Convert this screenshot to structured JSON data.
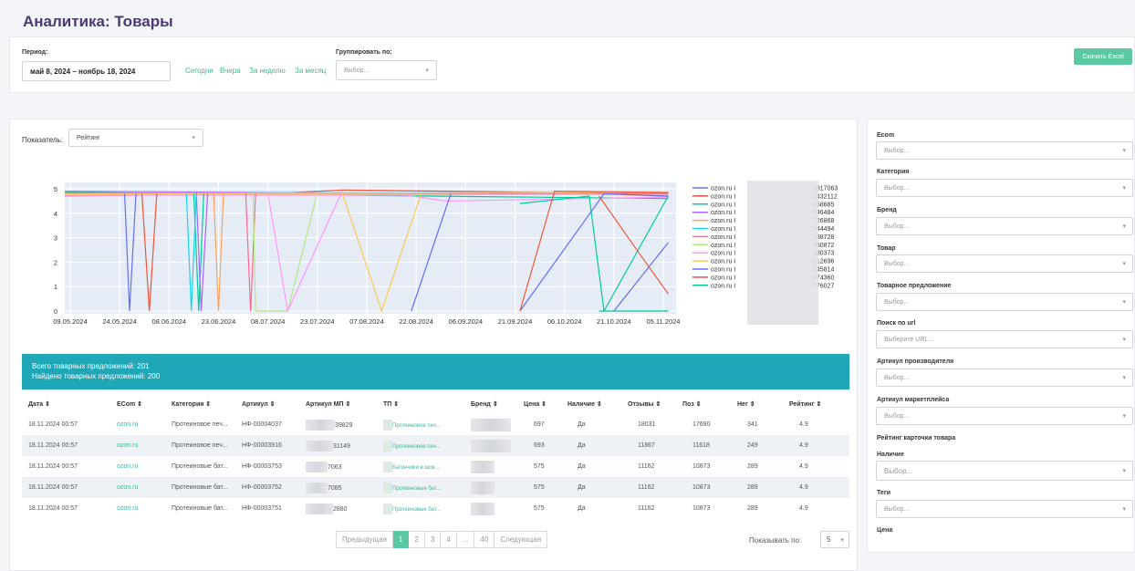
{
  "page_title": "Аналитика: Товары",
  "filters": {
    "period_label": "Период:",
    "period_value": "май 8, 2024 – ноябрь 18, 2024",
    "quick_links": [
      "Сегодня",
      "Вчера",
      "За неделю",
      "За месяц"
    ],
    "group_label": "Группировать по:",
    "group_placeholder": "Выбор...",
    "excel_button": "Скачать Excel"
  },
  "metric": {
    "label": "Показатель:",
    "value": "Рейтинг"
  },
  "chart_data": {
    "type": "line",
    "x": [
      "09.05.2024",
      "24.05.2024",
      "08.06.2024",
      "23.06.2024",
      "08.07.2024",
      "23.07.2024",
      "07.08.2024",
      "22.08.2024",
      "06.09.2024",
      "21.09.2024",
      "06.10.2024",
      "21.10.2024",
      "05.11.2024"
    ],
    "y_ticks": [
      "0",
      "1",
      "2",
      "3",
      "4",
      "5"
    ],
    "ylim": [
      0,
      5
    ],
    "legend_position": "right",
    "series": [
      {
        "name": "ozon.ru I",
        "suffix": "1817063",
        "color": "#636efa"
      },
      {
        "name": "ozon.ru I",
        "suffix": "7432112",
        "color": "#ef553b"
      },
      {
        "name": "ozon.ru I",
        "suffix": "458685",
        "color": "#00cc96"
      },
      {
        "name": "ozon.ru I",
        "suffix": "746484",
        "color": "#ab63fa"
      },
      {
        "name": "ozon.ru I",
        "suffix": "726868",
        "color": "#ffa15a"
      },
      {
        "name": "ozon.ru I",
        "suffix": "344494",
        "color": "#19d3f3"
      },
      {
        "name": "ozon.ru I",
        "suffix": "338728",
        "color": "#ff6692"
      },
      {
        "name": "ozon.ru I",
        "suffix": "350872",
        "color": "#b6e880"
      },
      {
        "name": "ozon.ru I",
        "suffix": "380373",
        "color": "#ff97ff"
      },
      {
        "name": "ozon.ru I",
        "suffix": "512696",
        "color": "#fecb52"
      },
      {
        "name": "ozon.ru I",
        "suffix": "545814",
        "color": "#636efa"
      },
      {
        "name": "ozon.ru I",
        "suffix": "074360",
        "color": "#ef553b"
      },
      {
        "name": "ozon.ru I",
        "suffix": "076027",
        "color": "#00cc96"
      }
    ]
  },
  "summary": {
    "total": "Всего товарных предложений: 201",
    "found": "Найдено товарных предложений: 200"
  },
  "table": {
    "columns": [
      "Дата ⇕",
      "ECom ⇕",
      "Категория ⇕",
      "Артикул ⇕",
      "Артикул МП ⇕",
      "ТП ⇕",
      "Бренд ⇕",
      "Цена ⇕",
      "Наличие ⇕",
      "Отзывы ⇕",
      "Поз ⇕",
      "Нег ⇕",
      "Рейтинг ⇕"
    ],
    "rows": [
      {
        "date": "18.11.2024 00:57",
        "ecom": "ozon.ru",
        "category": "Протеиновое печ...",
        "article": "НФ-00004037",
        "article_mp": "39829",
        "tp": "Протеиновое печ...",
        "price": "697",
        "stock": "Да",
        "reviews": "18031",
        "pos": "17690",
        "neg": "341",
        "rating": "4.9"
      },
      {
        "date": "18.11.2024 00:57",
        "ecom": "ozon.ru",
        "category": "Протеиновое печ...",
        "article": "НФ-00003916",
        "article_mp": "31149",
        "tp": "Протеиновое печ...",
        "price": "693",
        "stock": "Да",
        "reviews": "11867",
        "pos": "11618",
        "neg": "249",
        "rating": "4.9"
      },
      {
        "date": "18.11.2024 00:57",
        "ecom": "ozon.ru",
        "category": "Протеиновые бат...",
        "article": "НФ-00003753",
        "article_mp": "7063",
        "tp": "Батончики в шок...",
        "price": "575",
        "stock": "Да",
        "reviews": "11162",
        "pos": "10873",
        "neg": "289",
        "rating": "4.9"
      },
      {
        "date": "18.11.2024 00:57",
        "ecom": "ozon.ru",
        "category": "Протеиновые бат...",
        "article": "НФ-00003752",
        "article_mp": "7085",
        "tp": "Протеиновые бат...",
        "price": "575",
        "stock": "Да",
        "reviews": "11162",
        "pos": "10873",
        "neg": "289",
        "rating": "4.9"
      },
      {
        "date": "18.11.2024 00:57",
        "ecom": "ozon.ru",
        "category": "Протеиновые бат...",
        "article": "НФ-00003751",
        "article_mp": "2880",
        "tp": "Протеиновые бат...",
        "price": "575",
        "stock": "Да",
        "reviews": "11162",
        "pos": "10873",
        "neg": "289",
        "rating": "4.9"
      }
    ]
  },
  "pagination": {
    "prev": "Предыдущая",
    "pages": [
      "1",
      "2",
      "3",
      "4",
      "...",
      "40"
    ],
    "next": "Следующая",
    "per_page_label": "Показывать по:",
    "per_page_value": "5"
  },
  "sidebar": {
    "ecom_label": "Ecom",
    "category_label": "Категория",
    "brand_label": "Бренд",
    "product_label": "Товар",
    "offer_label": "Товарное предложение",
    "url_label": "Поиск по url",
    "url_placeholder": "Выберите URL...",
    "maker_article_label": "Артикул производителя",
    "mp_article_label": "Артикул маркетплейса",
    "card_rating_label": "Рейтинг карточки товара",
    "stock_label": "Наличие",
    "tags_label": "Теги",
    "price_label": "Цена",
    "placeholder": "Выбор..."
  }
}
